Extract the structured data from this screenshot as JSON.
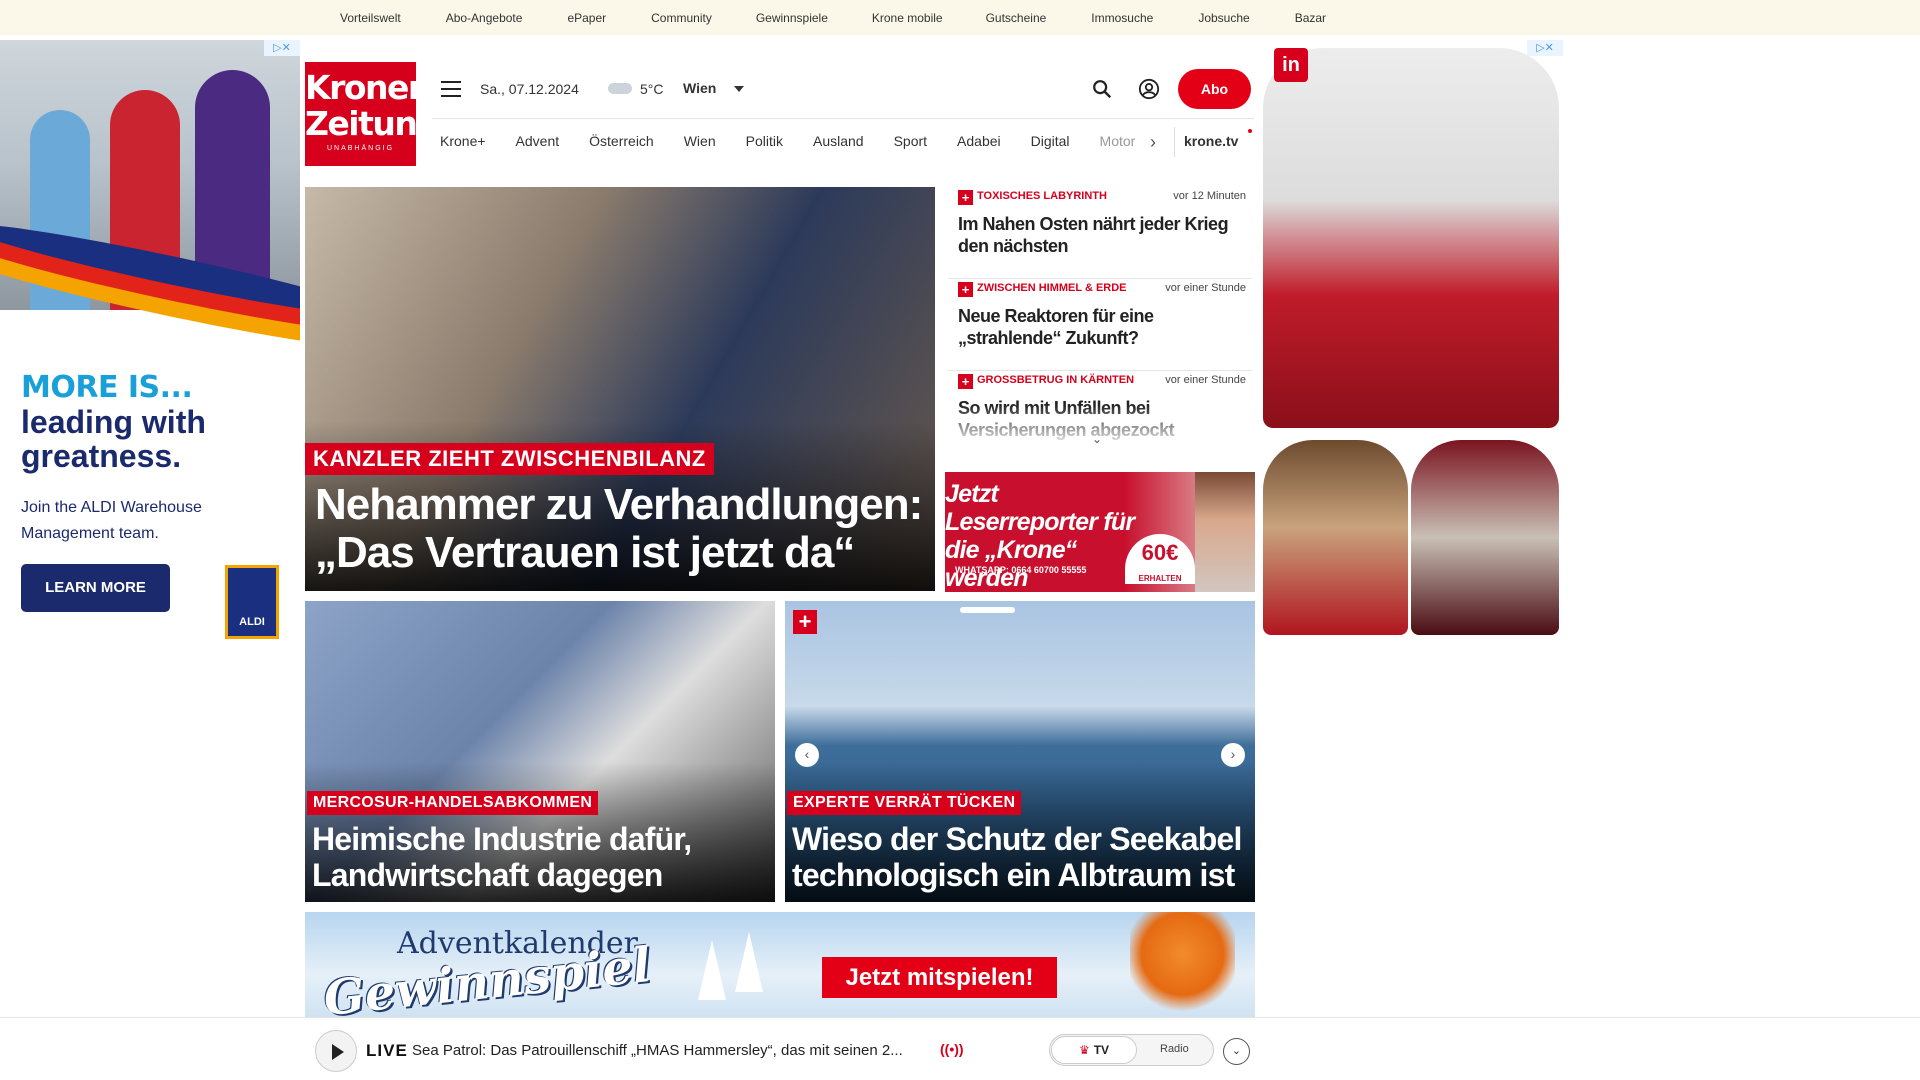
{
  "topbar": {
    "links": [
      "Vorteilswelt",
      "Abo-Angebote",
      "ePaper",
      "Community",
      "Gewinnspiele",
      "Krone mobile",
      "Gutscheine",
      "Immosuche",
      "Jobsuche",
      "Bazar"
    ]
  },
  "ad_left": {
    "more": "MORE IS...",
    "lead": "leading with greatness.",
    "join": "Join the ALDI Warehouse Management team.",
    "cta": "LEARN MORE",
    "brand": "ALDI"
  },
  "header": {
    "logo_line1": "Kronen",
    "logo_line2": "Zeitung",
    "logo_tagline": "UNABHÄNGIG",
    "date": "Sa., 07.12.2024",
    "temperature": "5°C",
    "city": "Wien",
    "abo_label": "Abo"
  },
  "nav": {
    "items": [
      "Krone+",
      "Advent",
      "Österreich",
      "Wien",
      "Politik",
      "Ausland",
      "Sport",
      "Adabei",
      "Digital"
    ],
    "faded_item": "Motor",
    "tv": "krone.tv"
  },
  "hero": {
    "kicker": "KANZLER ZIEHT ZWISCHENBILANZ",
    "headline": "Nehammer zu Verhandlungen: „Das Vertrauen ist jetzt da“"
  },
  "side_news": [
    {
      "category": "TOXISCHES LABYRINTH",
      "time": "vor 12 Minuten",
      "title": "Im Nahen Osten nährt jeder Krieg den nächsten"
    },
    {
      "category": "ZWISCHEN HIMMEL & ERDE",
      "time": "vor einer Stunde",
      "title": "Neue Reaktoren für eine „strahlende“ Zukunft?"
    },
    {
      "category": "GROSSBETRUG IN KÄRNTEN",
      "time": "vor einer Stunde",
      "title": "So wird mit Unfällen bei Versicherungen abgezockt"
    }
  ],
  "promo": {
    "title": "Jetzt Leserreporter für die „Krone“ werden",
    "whatsapp": "WHATSAPP: 0664 60700 55555",
    "amount": "60€",
    "amount_note": "ERHALTEN"
  },
  "tiles": [
    {
      "kicker": "MERCOSUR-HANDELSABKOMMEN",
      "headline": "Heimische Industrie dafür, Landwirtschaft dagegen"
    },
    {
      "kicker": "EXPERTE VERRÄT TÜCKEN",
      "headline": "Wieso der Schutz der Seekabel technologisch ein Albtraum ist"
    }
  ],
  "advent": {
    "title": "Adventkalender",
    "subtitle": "Gewinnspiel",
    "cta": "Jetzt mitspielen!"
  },
  "player": {
    "live": "LIVE",
    "text": "Sea Patrol: Das Patrouillenschiff „HMAS Hammersley“, das mit seinen 2...",
    "tv": "TV",
    "radio": "Radio"
  },
  "colors": {
    "brand_red": "#d6001c",
    "topbar_bg": "#fbf8ea",
    "aldi_navy": "#1a2a6c"
  }
}
